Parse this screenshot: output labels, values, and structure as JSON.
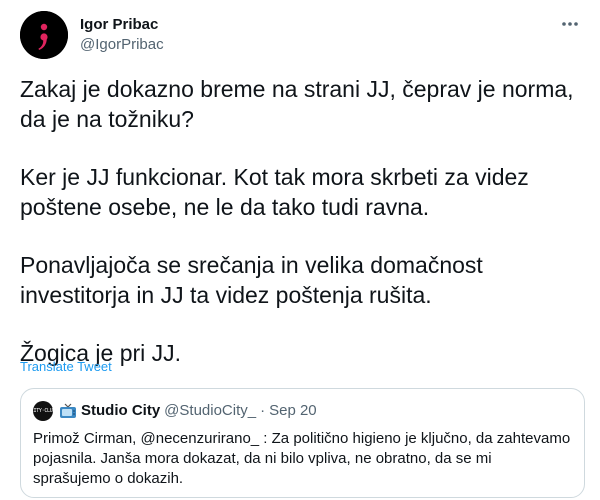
{
  "tweet": {
    "author": {
      "name": "Igor Pribac",
      "handle": "@IgorPribac"
    },
    "paragraphs": [
      "Zakaj je dokazno breme na strani JJ, čeprav je norma, da je na tožniku?",
      "Ker je JJ funkcionar. Kot tak mora skrbeti za videz poštene osebe, ne le da tako tudi ravna.",
      "Ponavljajoča se srečanja in velika domačnost investitorja in JJ ta videz poštenja rušita.",
      "Žogica je pri JJ."
    ],
    "translate_label": "Translate Tweet",
    "more_icon": "more-horizontal-icon"
  },
  "quoted_tweet": {
    "avatar_text": "CITY·CLUB",
    "emoji_icon": "television-icon",
    "name": "Studio City",
    "handle": "@StudioCity_",
    "separator": "·",
    "date": "Sep 20",
    "text": "Primož Cirman, @necenzurirano_ : Za politično higieno je ključno, da zahtevamo pojasnila. Janša mora dokazat, da ni bilo vpliva, ne obratno, da se mi sprašujemo o dokazih."
  },
  "colors": {
    "text": "#0f1419",
    "secondary": "#536471",
    "link": "#1d9bf0",
    "border": "#cfd9de",
    "avatar_bg": "#000000",
    "avatar_accent": "#e0245e"
  }
}
